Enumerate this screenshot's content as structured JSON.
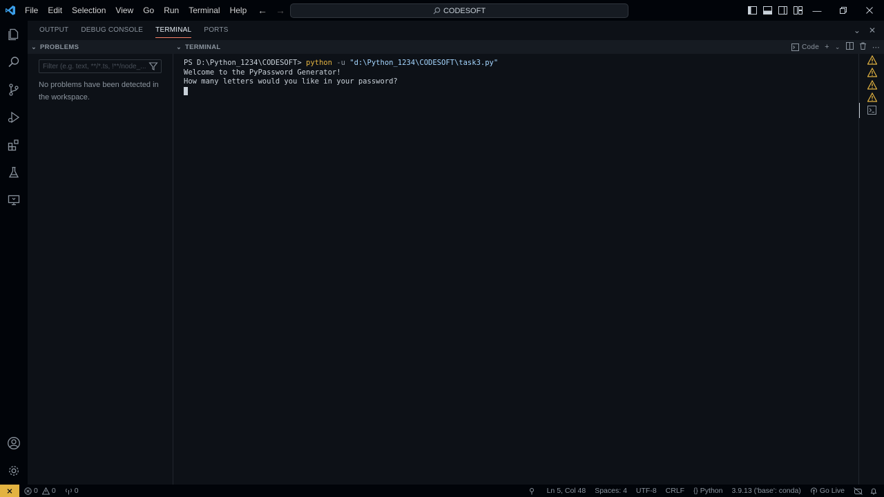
{
  "menu": [
    "File",
    "Edit",
    "Selection",
    "View",
    "Go",
    "Run",
    "Terminal",
    "Help"
  ],
  "title": "CODESOFT",
  "panel": {
    "tabs": [
      "OUTPUT",
      "DEBUG CONSOLE",
      "TERMINAL",
      "PORTS"
    ],
    "active_tab": "TERMINAL"
  },
  "problems": {
    "header": "PROBLEMS",
    "filter_placeholder": "Filter (e.g. text, **/*.ts, !**/node_...",
    "message": "No problems have been detected in the workspace."
  },
  "terminal": {
    "header": "TERMINAL",
    "shell_label": "Code",
    "prompt": "PS D:\\Python_1234\\CODESOFT> ",
    "command": "python",
    "flag": " -u ",
    "arg": "\"d:\\Python_1234\\CODESOFT\\task3.py\"",
    "output": [
      "Welcome to the PyPassword Generator!",
      "How many letters would you like in your password?"
    ]
  },
  "status": {
    "errors": "0",
    "warnings": "0",
    "ports": "0",
    "cursor_pos": "Ln 5, Col 48",
    "spaces": "Spaces: 4",
    "encoding": "UTF-8",
    "eol": "CRLF",
    "language": "Python",
    "interpreter": "3.9.13 ('base': conda)",
    "go_live": "Go Live"
  },
  "colors": {
    "accent": "#f78166",
    "warning": "#e3b341",
    "background": "#0d1117",
    "vscode_blue": "#3b9ee8"
  },
  "icons": {
    "activity": [
      "explorer-icon",
      "search-icon",
      "source-control-icon",
      "run-debug-icon",
      "extensions-icon",
      "testing-icon",
      "remote-explorer-icon",
      "account-icon",
      "settings-gear-icon"
    ]
  }
}
